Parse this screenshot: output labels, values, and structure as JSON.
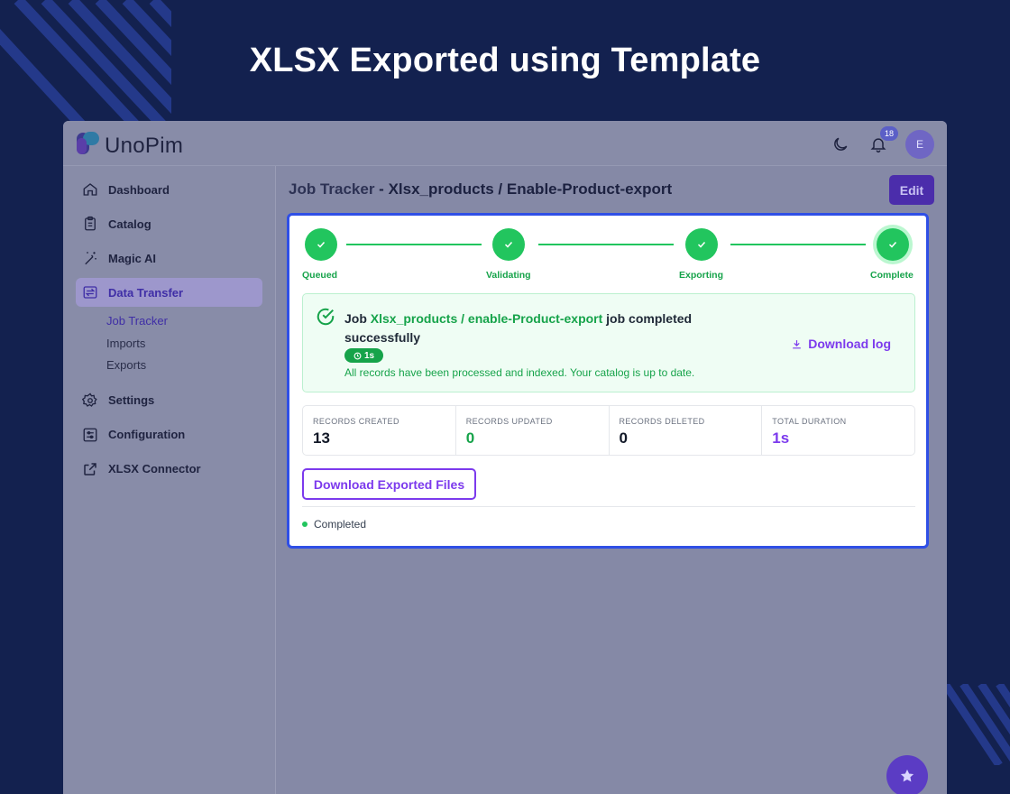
{
  "hero": {
    "title": "XLSX Exported using Template"
  },
  "app": {
    "brand": "UnoPim",
    "notifications_count": "18",
    "avatar_initial": "E"
  },
  "sidebar": {
    "items": [
      {
        "label": "Dashboard",
        "icon": "home-icon"
      },
      {
        "label": "Catalog",
        "icon": "clipboard-icon"
      },
      {
        "label": "Magic AI",
        "icon": "magic-wand-icon"
      },
      {
        "label": "Data Transfer",
        "icon": "transfer-icon",
        "active": true
      },
      {
        "label": "Settings",
        "icon": "gear-icon"
      },
      {
        "label": "Configuration",
        "icon": "sliders-icon"
      },
      {
        "label": "XLSX Connector",
        "icon": "share-icon"
      }
    ],
    "subitems": [
      "Job Tracker",
      "Imports",
      "Exports"
    ]
  },
  "header": {
    "label": "Job Tracker",
    "separator": " - ",
    "path": "Xlsx_products / Enable-Product-export",
    "edit_label": "Edit"
  },
  "stepper": {
    "steps": [
      "Queued",
      "Validating",
      "Exporting",
      "Complete"
    ]
  },
  "success": {
    "prefix": "Job ",
    "job_name": "Xlsx_products / enable-Product-export",
    "suffix": " job completed successfully",
    "duration_badge": "1s",
    "subtitle": "All records have been processed and indexed. Your catalog is up to date.",
    "download_log": "Download log"
  },
  "stats": [
    {
      "label": "RECORDS CREATED",
      "value": "13"
    },
    {
      "label": "RECORDS UPDATED",
      "value": "0"
    },
    {
      "label": "RECORDS DELETED",
      "value": "0"
    },
    {
      "label": "TOTAL DURATION",
      "value": "1s"
    }
  ],
  "download_files_label": "Download Exported Files",
  "status": "Completed",
  "colors": {
    "background": "#13214f",
    "accent": "#7c3aed",
    "success": "#22c55e",
    "card_border": "#2f4fe6"
  }
}
